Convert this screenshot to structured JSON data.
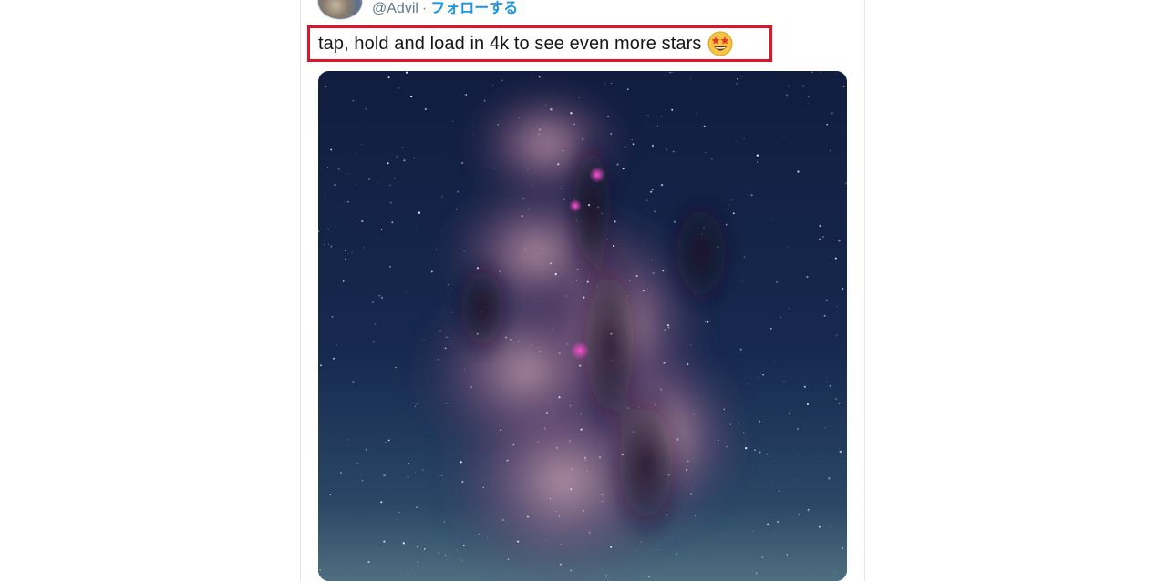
{
  "tweet": {
    "handle": "@Advil",
    "separator": "·",
    "follow_label": "フォローする",
    "text": "tap, hold and load in 4k to see even more stars",
    "emoji": "star-struck-emoji"
  },
  "highlight": {
    "color": "#e0142d"
  },
  "colors": {
    "link": "#1b95e0",
    "secondary_text": "#657786",
    "primary_text": "#14171a"
  },
  "media": {
    "subject": "milky-way-night-sky-photo"
  }
}
